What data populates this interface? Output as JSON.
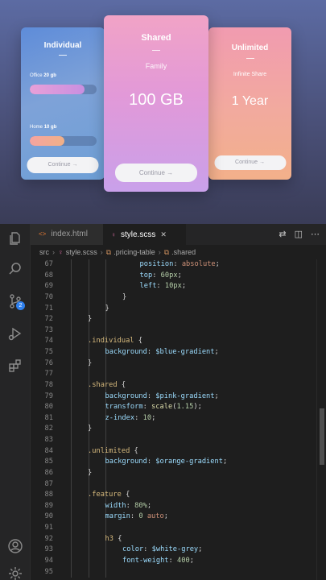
{
  "preview": {
    "individual": {
      "title": "Individual",
      "feature1_label": "Office",
      "feature1_value": "20 gb",
      "feature1_fill": 0.82,
      "feature2_label": "Home",
      "feature2_value": "10 gb",
      "feature2_fill": 0.52,
      "button": "Continue →"
    },
    "shared": {
      "title": "Shared",
      "subtitle": "Family",
      "value": "100 GB",
      "button": "Continue →"
    },
    "unlimited": {
      "title": "Unlimited",
      "subtitle": "Infinite Share",
      "value": "1 Year",
      "button": "Continue →"
    }
  },
  "editor": {
    "tabs": [
      {
        "label": "index.html",
        "icon": "<>"
      },
      {
        "label": "style.scss",
        "icon": "sass-icon"
      }
    ],
    "breadcrumb": [
      "src",
      "style.scss",
      ".pricing-table",
      ".shared"
    ],
    "badge_count": "2",
    "colors": {
      "selector": "#d7ba7d",
      "property": "#9cdcfe",
      "number": "#b5cea8",
      "value": "#ce9178",
      "line_number": "#858585"
    },
    "lines": [
      {
        "n": "67",
        "indent": 3,
        "parts": [
          [
            "prop",
            "position"
          ],
          [
            "p",
            ": "
          ],
          [
            "val",
            "absolute"
          ],
          [
            "p",
            ";"
          ]
        ]
      },
      {
        "n": "68",
        "indent": 3,
        "parts": [
          [
            "prop",
            "top"
          ],
          [
            "p",
            ": "
          ],
          [
            "num",
            "60px"
          ],
          [
            "p",
            ";"
          ]
        ]
      },
      {
        "n": "69",
        "indent": 3,
        "parts": [
          [
            "prop",
            "left"
          ],
          [
            "p",
            ": "
          ],
          [
            "num",
            "10px"
          ],
          [
            "p",
            ";"
          ]
        ]
      },
      {
        "n": "70",
        "indent": 2,
        "parts": [
          [
            "p",
            "}"
          ]
        ]
      },
      {
        "n": "71",
        "indent": 1,
        "parts": [
          [
            "p",
            "}"
          ]
        ]
      },
      {
        "n": "72",
        "indent": 0,
        "parts": [
          [
            "p",
            "}"
          ]
        ]
      },
      {
        "n": "73",
        "indent": 0,
        "parts": []
      },
      {
        "n": "74",
        "indent": 0,
        "parts": [
          [
            "sel",
            ".individual"
          ],
          [
            "p",
            " {"
          ]
        ]
      },
      {
        "n": "75",
        "indent": 1,
        "parts": [
          [
            "prop",
            "background"
          ],
          [
            "p",
            ": "
          ],
          [
            "var",
            "$blue-gradient"
          ],
          [
            "p",
            ";"
          ]
        ]
      },
      {
        "n": "76",
        "indent": 0,
        "parts": [
          [
            "p",
            "}"
          ]
        ]
      },
      {
        "n": "77",
        "indent": 0,
        "parts": []
      },
      {
        "n": "78",
        "indent": 0,
        "parts": [
          [
            "sel",
            ".shared"
          ],
          [
            "p",
            " {"
          ]
        ]
      },
      {
        "n": "79",
        "indent": 1,
        "parts": [
          [
            "prop",
            "background"
          ],
          [
            "p",
            ": "
          ],
          [
            "var",
            "$pink-gradient"
          ],
          [
            "p",
            ";"
          ]
        ]
      },
      {
        "n": "80",
        "indent": 1,
        "parts": [
          [
            "prop",
            "transform"
          ],
          [
            "p",
            ": "
          ],
          [
            "fn",
            "scale"
          ],
          [
            "p",
            "("
          ],
          [
            "num",
            "1.15"
          ],
          [
            "p",
            ");"
          ]
        ]
      },
      {
        "n": "81",
        "indent": 1,
        "parts": [
          [
            "prop",
            "z-index"
          ],
          [
            "p",
            ": "
          ],
          [
            "num",
            "10"
          ],
          [
            "p",
            ";"
          ]
        ]
      },
      {
        "n": "82",
        "indent": 0,
        "parts": [
          [
            "p",
            "}"
          ]
        ]
      },
      {
        "n": "83",
        "indent": 0,
        "parts": []
      },
      {
        "n": "84",
        "indent": 0,
        "parts": [
          [
            "sel",
            ".unlimited"
          ],
          [
            "p",
            " {"
          ]
        ]
      },
      {
        "n": "85",
        "indent": 1,
        "parts": [
          [
            "prop",
            "background"
          ],
          [
            "p",
            ": "
          ],
          [
            "var",
            "$orange-gradient"
          ],
          [
            "p",
            ";"
          ]
        ]
      },
      {
        "n": "86",
        "indent": 0,
        "parts": [
          [
            "p",
            "}"
          ]
        ]
      },
      {
        "n": "87",
        "indent": 0,
        "parts": []
      },
      {
        "n": "88",
        "indent": 0,
        "parts": [
          [
            "sel",
            ".feature"
          ],
          [
            "p",
            " {"
          ]
        ]
      },
      {
        "n": "89",
        "indent": 1,
        "parts": [
          [
            "prop",
            "width"
          ],
          [
            "p",
            ": "
          ],
          [
            "num",
            "80%"
          ],
          [
            "p",
            ";"
          ]
        ]
      },
      {
        "n": "90",
        "indent": 1,
        "parts": [
          [
            "prop",
            "margin"
          ],
          [
            "p",
            ": "
          ],
          [
            "num",
            "0"
          ],
          [
            "p",
            " "
          ],
          [
            "val",
            "auto"
          ],
          [
            "p",
            ";"
          ]
        ]
      },
      {
        "n": "91",
        "indent": 0,
        "parts": []
      },
      {
        "n": "92",
        "indent": 1,
        "parts": [
          [
            "sel",
            "h3"
          ],
          [
            "p",
            " {"
          ]
        ]
      },
      {
        "n": "93",
        "indent": 2,
        "parts": [
          [
            "prop",
            "color"
          ],
          [
            "p",
            ": "
          ],
          [
            "var",
            "$white-grey"
          ],
          [
            "p",
            ";"
          ]
        ]
      },
      {
        "n": "94",
        "indent": 2,
        "parts": [
          [
            "prop",
            "font-weight"
          ],
          [
            "p",
            ": "
          ],
          [
            "num",
            "400"
          ],
          [
            "p",
            ";"
          ]
        ]
      },
      {
        "n": "95",
        "indent": 0,
        "parts": []
      }
    ]
  }
}
